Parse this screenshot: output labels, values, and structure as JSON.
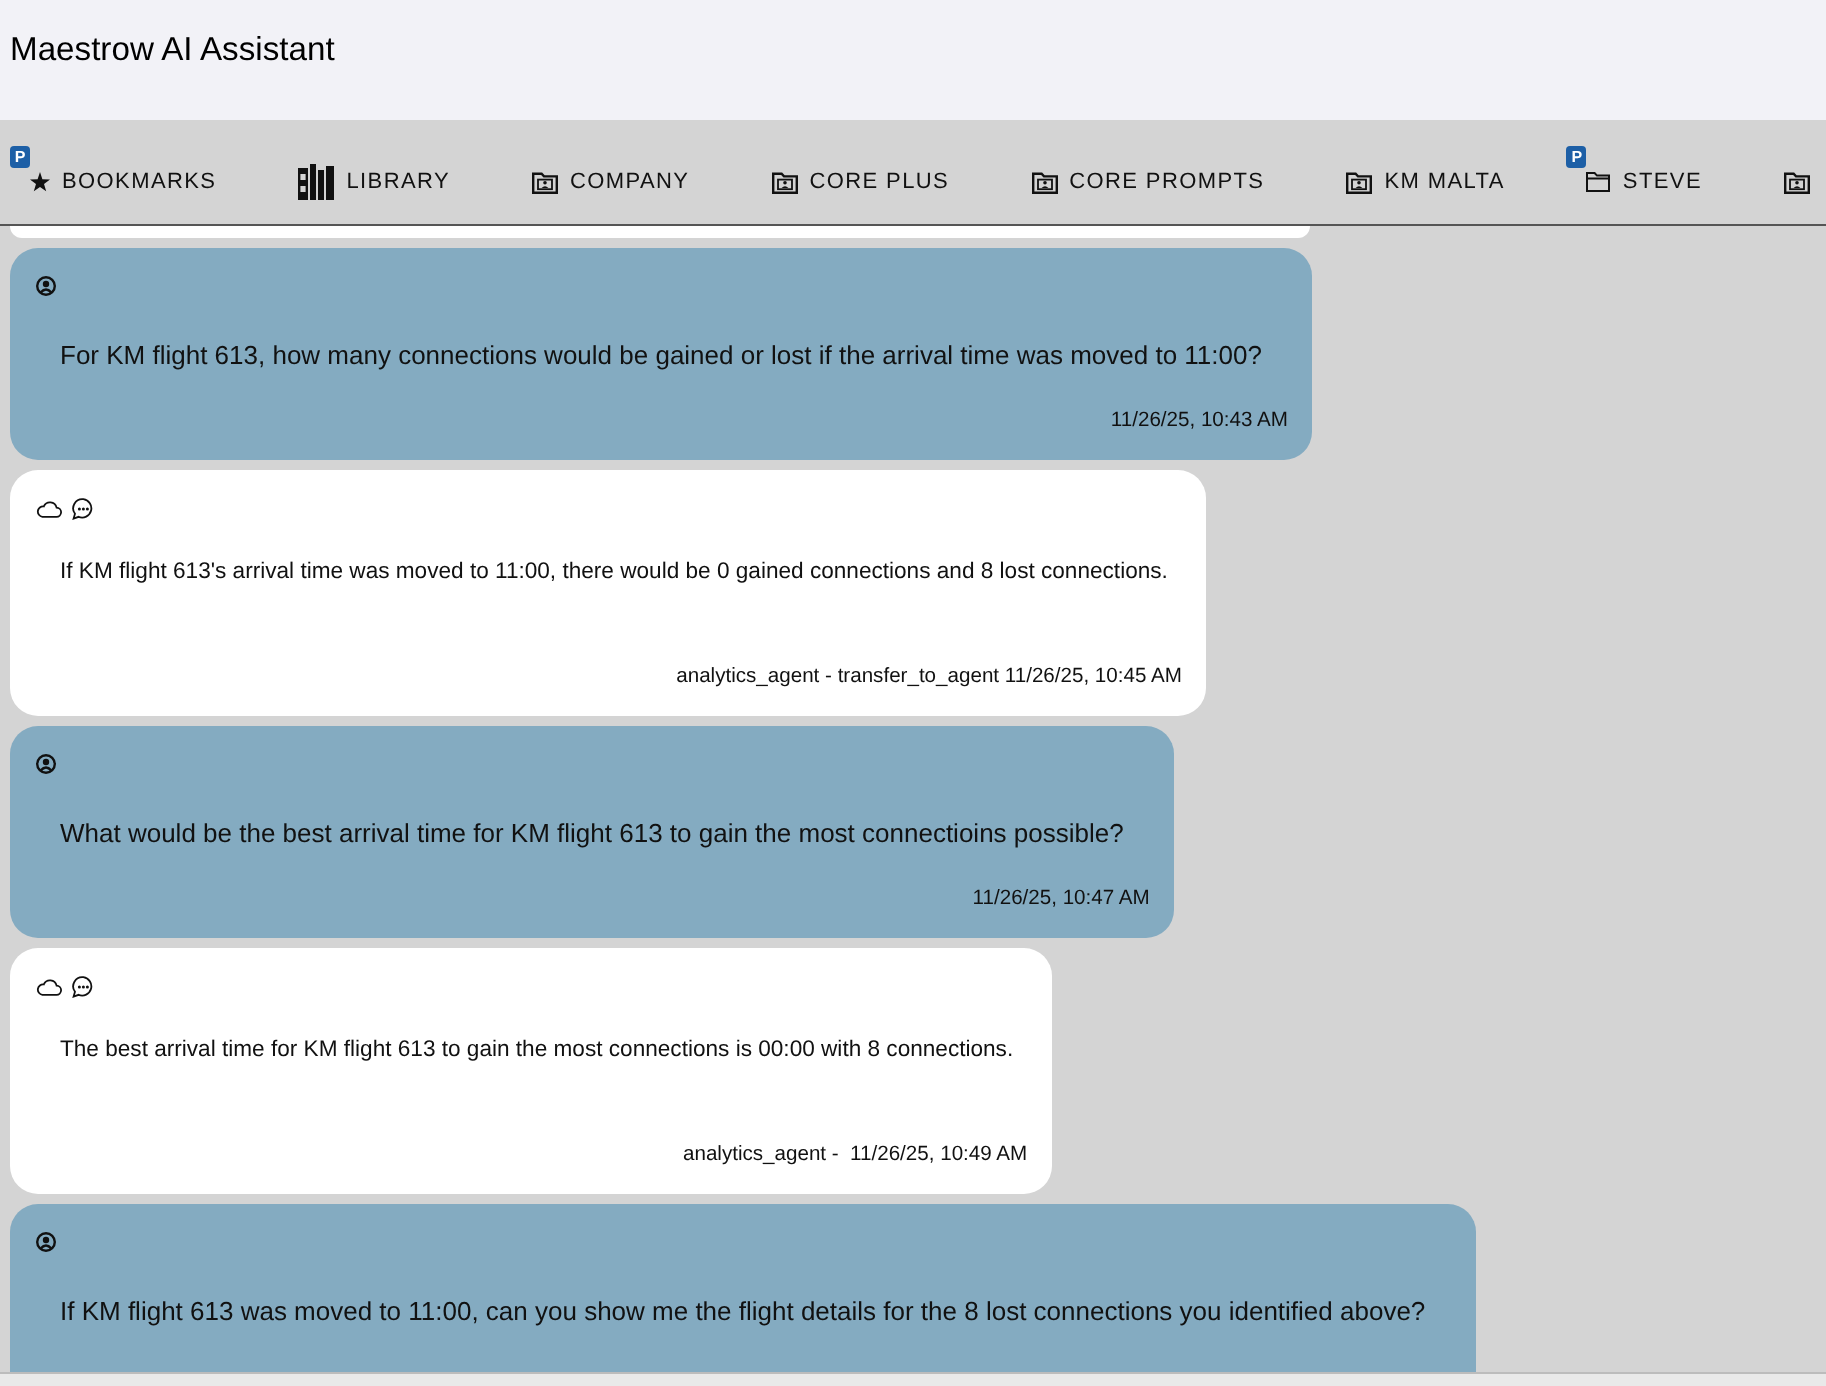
{
  "window": {
    "title": "Maestrow AI Assistant"
  },
  "tabs": [
    {
      "badge": "P",
      "kind": "star",
      "label": "BOOKMARKS"
    },
    {
      "kind": "books",
      "label": "LIBRARY"
    },
    {
      "kind": "shared-folder",
      "label": "COMPANY"
    },
    {
      "kind": "shared-folder",
      "label": "CORE PLUS"
    },
    {
      "kind": "shared-folder",
      "label": "CORE PROMPTS"
    },
    {
      "kind": "shared-folder",
      "label": "KM MALTA"
    },
    {
      "badge": "P",
      "kind": "folder",
      "label": "STEVE"
    },
    {
      "kind": "shared-folder"
    }
  ],
  "messages": [
    {
      "kind": "user",
      "text": "For KM flight 613, how many connections would be gained or lost if the arrival time was moved to 11:00?",
      "meta": "11/26/25, 10:43 AM"
    },
    {
      "kind": "assistant",
      "text": "If KM flight 613's arrival time was moved to 11:00, there would be 0 gained connections and 8 lost connections.",
      "meta": "analytics_agent - transfer_to_agent 11/26/25, 10:45 AM"
    },
    {
      "kind": "user",
      "text": "What would be the best arrival time for KM flight 613 to gain the most connectioins possible?",
      "meta": "11/26/25, 10:47 AM"
    },
    {
      "kind": "assistant",
      "text": "The best arrival time for KM flight 613 to gain the most connections is 00:00 with 8 connections.",
      "meta": "analytics_agent -  11/26/25, 10:49 AM"
    },
    {
      "kind": "user",
      "text": "If KM flight 613 was moved to 11:00, can you show me the flight details for the 8 lost connections you identified above?"
    }
  ]
}
